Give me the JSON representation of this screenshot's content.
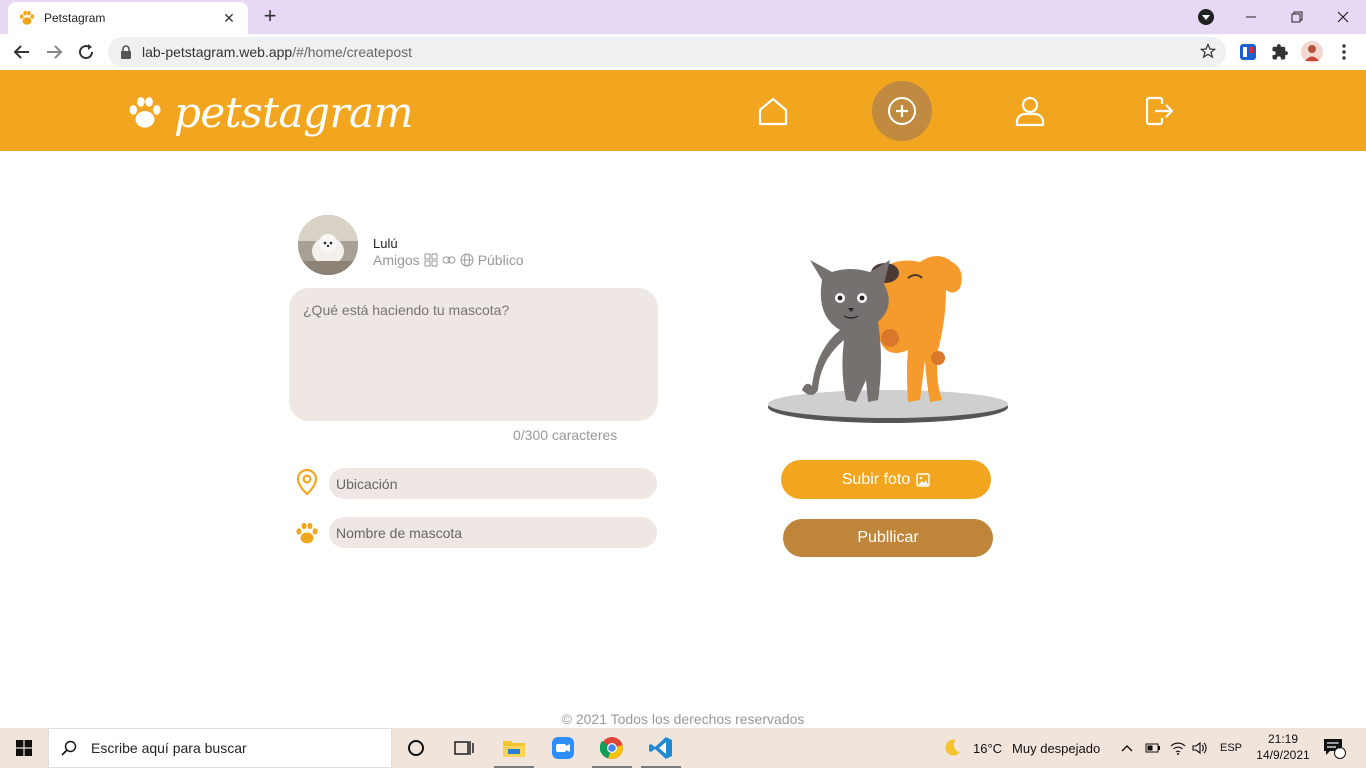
{
  "browser": {
    "tab_title": "Petstagram",
    "url_host": "lab-petstagram.web.app",
    "url_path": "/#/home/createpost"
  },
  "header": {
    "brand": "petstagram",
    "nav": [
      {
        "name": "home",
        "icon": "home-icon"
      },
      {
        "name": "create-post",
        "icon": "add-circle-icon",
        "active": true
      },
      {
        "name": "profile",
        "icon": "user-icon"
      },
      {
        "name": "logout",
        "icon": "logout-icon"
      }
    ]
  },
  "post_form": {
    "user_name": "Lulú",
    "privacy_options": [
      "Amigos",
      "Público"
    ],
    "description_placeholder": "¿Qué está haciendo tu mascota?",
    "char_counter": "0/300 caracteres",
    "location_placeholder": "Ubicación",
    "pet_name_placeholder": "Nombre de mascota",
    "upload_button": "Subir foto",
    "publish_button": "Publlicar"
  },
  "footer": {
    "text": "© 2021 Todos los derechos reservados"
  },
  "taskbar": {
    "search_placeholder": "Escribe aquí para buscar",
    "weather_temp": "16°C",
    "weather_desc": "Muy despejado",
    "language": "ESP",
    "time": "21:19",
    "date": "14/9/2021",
    "notifications": "4"
  },
  "colors": {
    "brand_orange": "#f2a61f",
    "brand_brown": "#be853b",
    "input_bg": "#efe7e3",
    "tab_strip": "#e7d9f5"
  }
}
